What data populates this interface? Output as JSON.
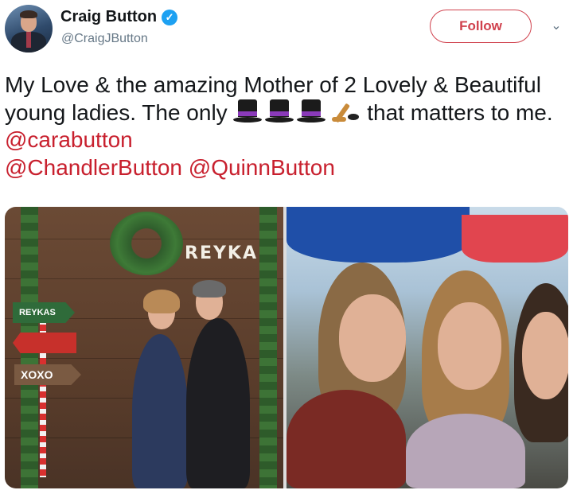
{
  "user": {
    "name": "Craig Button",
    "handle": "@CraigJButton",
    "verified_mark": "✓"
  },
  "follow_button": {
    "label": "Follow"
  },
  "menu_caret": "⌄",
  "tweet": {
    "part1": "My Love & the amazing Mother of 2 Lovely & Beautiful young ladies. The only ",
    "emoji": [
      "top-hat-icon",
      "top-hat-icon",
      "top-hat-icon",
      "hockey-icon"
    ],
    "part2": " that matters to me. ",
    "mention1": "@carabutton",
    "mention2": "@ChandlerButton",
    "mention3": "@QuinnButton"
  },
  "photo_left": {
    "sign": "REYKA",
    "arrow1": "REYKAS",
    "arrow2": "",
    "arrow3": "XOXO"
  },
  "colors": {
    "accent_red": "#c8202e",
    "follow_border": "#d0414d",
    "verified_blue": "#1da1f2",
    "secondary_text": "#657786"
  }
}
